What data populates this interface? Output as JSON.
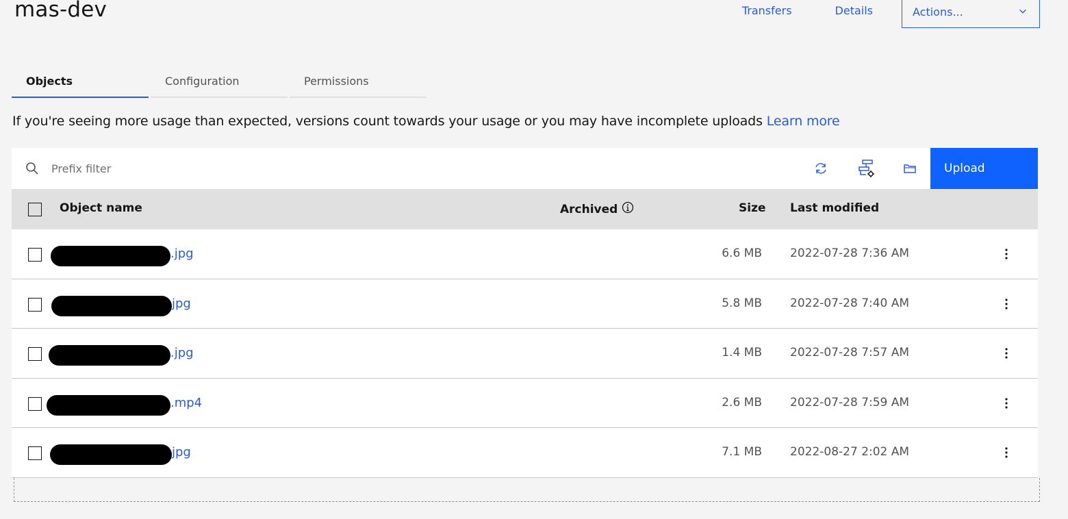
{
  "bucket": {
    "title": "mas-dev"
  },
  "header": {
    "transfers_label": "Transfers",
    "details_label": "Details",
    "actions_label": "Actions..."
  },
  "tabs": [
    {
      "label": "Objects",
      "active": true
    },
    {
      "label": "Configuration",
      "active": false
    },
    {
      "label": "Permissions",
      "active": false
    }
  ],
  "notice": {
    "text": "If you're seeing more usage than expected, versions count towards your usage or you may have incomplete uploads",
    "link_label": "Learn more"
  },
  "toolbar": {
    "search_placeholder": "Prefix filter",
    "icons": [
      "search-icon",
      "refresh-icon",
      "transfer-settings-icon",
      "folder-icon"
    ],
    "upload_label": "Upload"
  },
  "table": {
    "columns": {
      "name": "Object name",
      "archived": "Archived",
      "size": "Size",
      "modified": "Last modified"
    },
    "rows": [
      {
        "name_suffix": ".jpg",
        "size": "6.6 MB",
        "modified": "2022-07-28 7:36 AM"
      },
      {
        "name_suffix": "jpg",
        "size": "5.8 MB",
        "modified": "2022-07-28 7:40 AM"
      },
      {
        "name_suffix": ".jpg",
        "size": "1.4 MB",
        "modified": "2022-07-28 7:57 AM"
      },
      {
        "name_suffix": ".mp4",
        "size": "2.6 MB",
        "modified": "2022-07-28 7:59 AM"
      },
      {
        "name_suffix": "jpg",
        "size": "7.1 MB",
        "modified": "2022-08-27 2:02 AM"
      }
    ]
  },
  "colors": {
    "link": "#2a5bd7",
    "primary_button": "#0f62fe",
    "header_row": "#e0e0e0",
    "page_background": "#f4f4f4"
  }
}
